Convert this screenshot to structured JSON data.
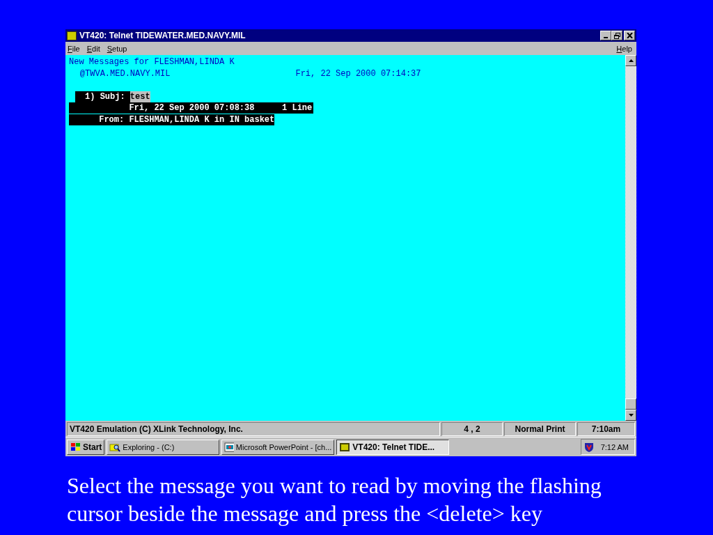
{
  "window": {
    "title": "VT420: Telnet TIDEWATER.MED.NAVY.MIL"
  },
  "menu": {
    "left": [
      {
        "label": "File"
      },
      {
        "label": "Edit"
      },
      {
        "label": "Setup"
      }
    ],
    "right": [
      {
        "label": "Help"
      }
    ]
  },
  "terminal": {
    "header": "New Messages for FLESHMAN,LINDA K",
    "host": "@TWVA.MED.NAVY.MIL",
    "now": "Fri, 22 Sep 2000 07:14:37",
    "messages": [
      {
        "number": "1)",
        "subj_label": "Subj:",
        "subject": "test",
        "date": "Fri, 22 Sep 2000 07:08:38",
        "size": "1 Line",
        "from_label": "From:",
        "from": "FLESHMAN,LINDA K in IN basket",
        "selected": true
      }
    ]
  },
  "status_bar": [
    "VT420 Emulation (C) XLink Technology, Inc.",
    "4 , 2",
    "Normal Print",
    "7:10am"
  ],
  "taskbar": {
    "start": "Start",
    "tasks": [
      {
        "label": "Exploring - (C:)",
        "kind": "explorer",
        "selected": false
      },
      {
        "label": "Microsoft PowerPoint - [ch...",
        "kind": "powerpoint",
        "selected": false
      },
      {
        "label": "VT420: Telnet TIDE...",
        "kind": "terminal",
        "selected": true
      }
    ],
    "clock": "7:12 AM"
  },
  "caption": "Select the message you want to read by moving the flashing cursor beside the message and press the <delete> key"
}
